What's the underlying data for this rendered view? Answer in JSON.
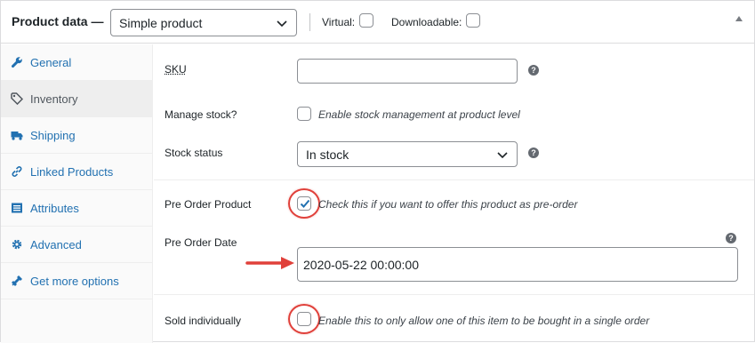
{
  "header": {
    "title": "Product data —",
    "product_type": "Simple product",
    "virtual_label": "Virtual:",
    "downloadable_label": "Downloadable:"
  },
  "sidebar": {
    "items": [
      {
        "label": "General",
        "icon": "wrench-icon"
      },
      {
        "label": "Inventory",
        "icon": "tag-icon"
      },
      {
        "label": "Shipping",
        "icon": "truck-icon"
      },
      {
        "label": "Linked Products",
        "icon": "link-icon"
      },
      {
        "label": "Attributes",
        "icon": "list-icon"
      },
      {
        "label": "Advanced",
        "icon": "gear-icon"
      },
      {
        "label": "Get more options",
        "icon": "plugin-icon"
      }
    ],
    "active_index": 1
  },
  "fields": {
    "sku": {
      "label": "SKU",
      "value": ""
    },
    "manage_stock": {
      "label": "Manage stock?",
      "description": "Enable stock management at product level",
      "checked": false
    },
    "stock_status": {
      "label": "Stock status",
      "value": "In stock"
    },
    "pre_order": {
      "label": "Pre Order Product",
      "description": "Check this if you want to offer this product as pre-order",
      "checked": true
    },
    "pre_order_date": {
      "label": "Pre Order Date",
      "value": "2020-05-22 00:00:00"
    },
    "sold_individually": {
      "label": "Sold individually",
      "description": "Enable this to only allow one of this item to be bought in a single order",
      "checked": false
    }
  },
  "colors": {
    "link": "#2271b1",
    "annotation_red": "#e0403a",
    "check_blue": "#2271b1"
  }
}
